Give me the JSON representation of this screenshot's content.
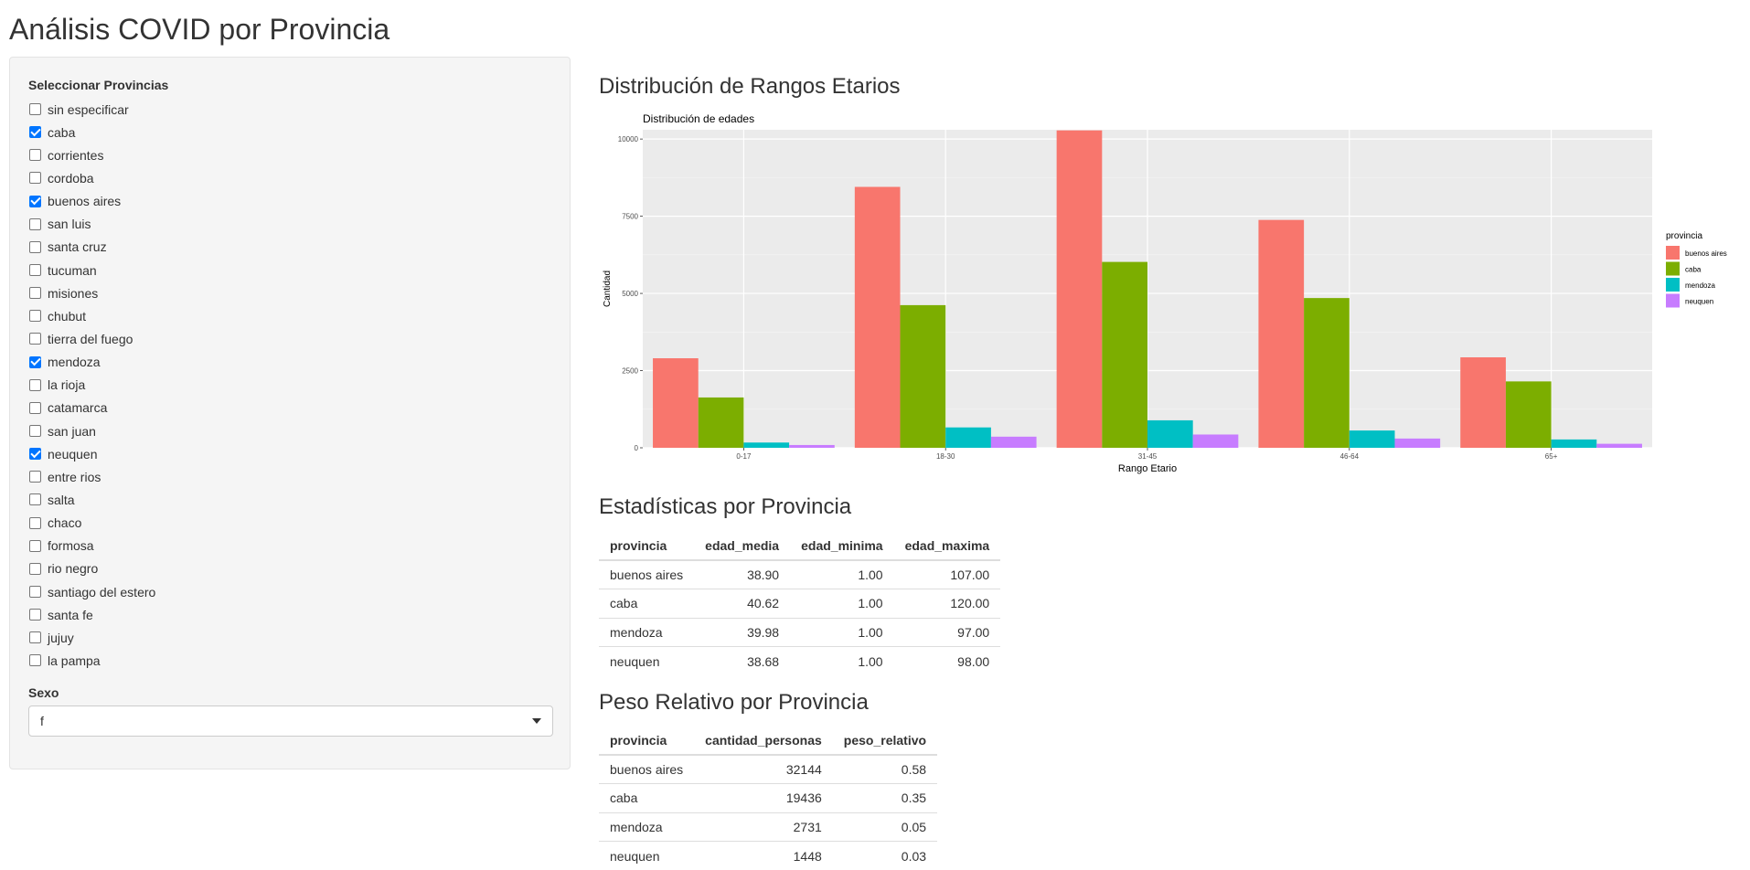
{
  "page": {
    "title": "Análisis COVID por Provincia"
  },
  "sidebar": {
    "provinces_label": "Seleccionar Provincias",
    "provinces": [
      {
        "label": "sin especificar",
        "checked": false
      },
      {
        "label": "caba",
        "checked": true
      },
      {
        "label": "corrientes",
        "checked": false
      },
      {
        "label": "cordoba",
        "checked": false
      },
      {
        "label": "buenos aires",
        "checked": true
      },
      {
        "label": "san luis",
        "checked": false
      },
      {
        "label": "santa cruz",
        "checked": false
      },
      {
        "label": "tucuman",
        "checked": false
      },
      {
        "label": "misiones",
        "checked": false
      },
      {
        "label": "chubut",
        "checked": false
      },
      {
        "label": "tierra del fuego",
        "checked": false
      },
      {
        "label": "mendoza",
        "checked": true
      },
      {
        "label": "la rioja",
        "checked": false
      },
      {
        "label": "catamarca",
        "checked": false
      },
      {
        "label": "san juan",
        "checked": false
      },
      {
        "label": "neuquen",
        "checked": true
      },
      {
        "label": "entre rios",
        "checked": false
      },
      {
        "label": "salta",
        "checked": false
      },
      {
        "label": "chaco",
        "checked": false
      },
      {
        "label": "formosa",
        "checked": false
      },
      {
        "label": "rio negro",
        "checked": false
      },
      {
        "label": "santiago del estero",
        "checked": false
      },
      {
        "label": "santa fe",
        "checked": false
      },
      {
        "label": "jujuy",
        "checked": false
      },
      {
        "label": "la pampa",
        "checked": false
      }
    ],
    "sex_label": "Sexo",
    "sex_selected": "f"
  },
  "sections": {
    "chart_title": "Distribución de Rangos Etarios",
    "stats_title": "Estadísticas por Provincia",
    "weight_title": "Peso Relativo por Provincia"
  },
  "chart_data": {
    "type": "bar",
    "title": "Distribución de edades",
    "xlabel": "Rango Etario",
    "ylabel": "Cantidad",
    "categories": [
      "0-17",
      "18-30",
      "31-45",
      "46-64",
      "65+"
    ],
    "ylim": [
      0,
      10300
    ],
    "yticks": [
      0,
      2500,
      5000,
      7500,
      10000
    ],
    "grid": true,
    "legend_title": "provincia",
    "legend_position": "right",
    "series": [
      {
        "name": "buenos aires",
        "color": "#F8766D",
        "values": [
          2900,
          8450,
          10280,
          7380,
          2930
        ]
      },
      {
        "name": "caba",
        "color": "#7CAE00",
        "values": [
          1630,
          4620,
          6020,
          4850,
          2150
        ]
      },
      {
        "name": "mendoza",
        "color": "#00BFC4",
        "values": [
          170,
          660,
          890,
          560,
          270
        ]
      },
      {
        "name": "neuquen",
        "color": "#C77CFF",
        "values": [
          90,
          360,
          430,
          300,
          130
        ]
      }
    ]
  },
  "stats_table": {
    "headers": [
      "provincia",
      "edad_media",
      "edad_minima",
      "edad_maxima"
    ],
    "rows": [
      [
        "buenos aires",
        "38.90",
        "1.00",
        "107.00"
      ],
      [
        "caba",
        "40.62",
        "1.00",
        "120.00"
      ],
      [
        "mendoza",
        "39.98",
        "1.00",
        "97.00"
      ],
      [
        "neuquen",
        "38.68",
        "1.00",
        "98.00"
      ]
    ]
  },
  "weight_table": {
    "headers": [
      "provincia",
      "cantidad_personas",
      "peso_relativo"
    ],
    "rows": [
      [
        "buenos aires",
        "32144",
        "0.58"
      ],
      [
        "caba",
        "19436",
        "0.35"
      ],
      [
        "mendoza",
        "2731",
        "0.05"
      ],
      [
        "neuquen",
        "1448",
        "0.03"
      ]
    ]
  }
}
